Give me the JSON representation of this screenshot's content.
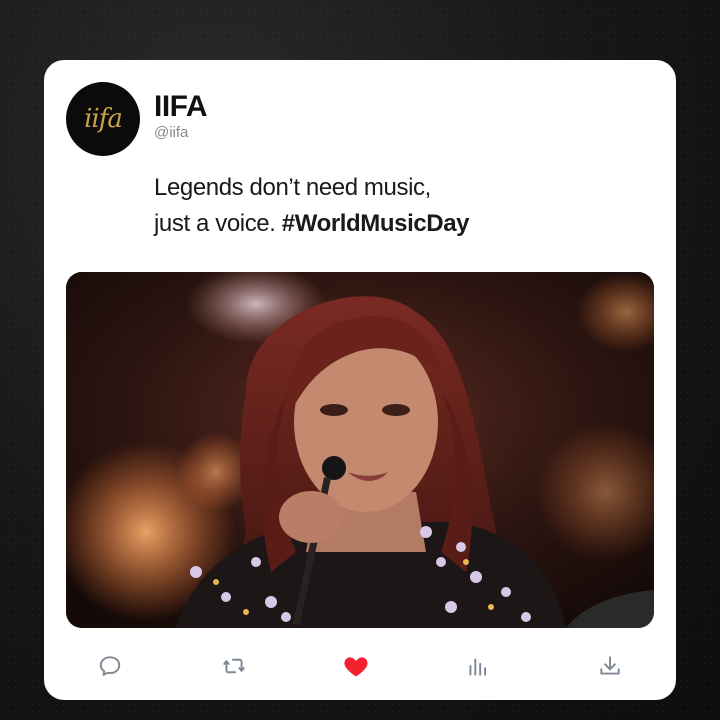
{
  "profile": {
    "display_name": "IIFA",
    "handle": "@iifa",
    "logo_text": "iifa"
  },
  "tweet": {
    "line1": "Legends don’t need music,",
    "line2_prefix": "just a voice. ",
    "hashtag": "#WorldMusicDay"
  },
  "media": {
    "description_icon": "photo"
  },
  "actions": [
    {
      "icon": "reply-icon"
    },
    {
      "icon": "retweet-icon"
    },
    {
      "icon": "heart-icon",
      "liked": true,
      "color": "#f4212e"
    },
    {
      "icon": "analytics-icon"
    },
    {
      "icon": "share-icon"
    }
  ],
  "colors": {
    "accent_like": "#f4212e",
    "icon_default": "#7f8a95",
    "logo_gold": "#c9a14a"
  }
}
